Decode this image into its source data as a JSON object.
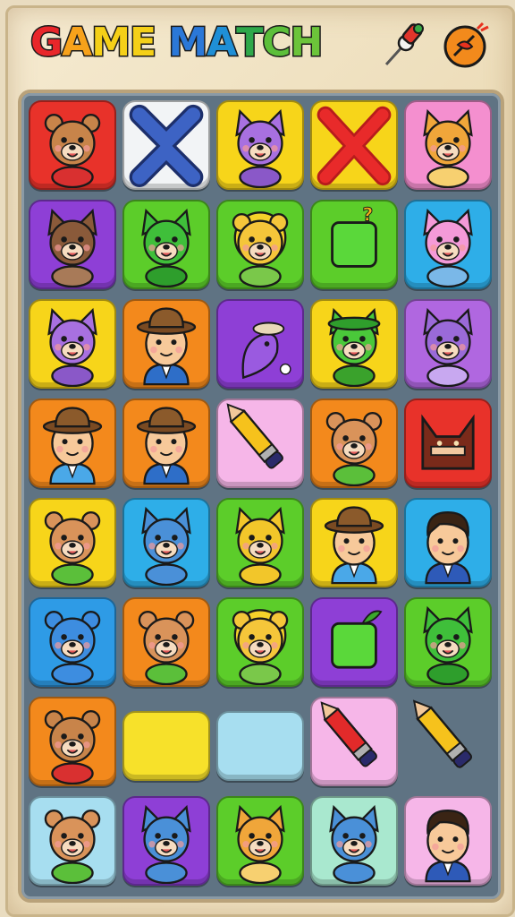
{
  "title": {
    "letters": [
      {
        "ch": "G",
        "color": "#e8262a"
      },
      {
        "ch": "A",
        "color": "#f7a21b"
      },
      {
        "ch": "M",
        "color": "#f5d018"
      },
      {
        "ch": "E",
        "color": "#f5d018"
      },
      {
        "ch": " ",
        "color": "#000000"
      },
      {
        "ch": "M",
        "color": "#2b78d8"
      },
      {
        "ch": "A",
        "color": "#1f8fd6"
      },
      {
        "ch": "T",
        "color": "#2ea84a"
      },
      {
        "ch": "C",
        "color": "#5cbf3a"
      },
      {
        "ch": "H",
        "color": "#6cc43a"
      }
    ]
  },
  "header_icons": [
    "pushpin-icon",
    "fire-shield-icon"
  ],
  "colors": {
    "red": "#e8322a",
    "white": "#f2f4f6",
    "yellow": "#f7d51a",
    "pink": "#f48fcf",
    "purple": "#8e3fd6",
    "green": "#5ccd2a",
    "lightblue": "#2eaee8",
    "orange": "#f3891c",
    "violet": "#b067e0",
    "blue": "#2e9be6",
    "paleblue": "#a7def0",
    "lightpink": "#f6b6e8",
    "mint": "#a9e8cf",
    "lightyellow": "#f7e12a"
  },
  "rows": [
    [
      {
        "bg": "red",
        "icon": "bear-man-icon"
      },
      {
        "bg": "white",
        "icon": "blue-x-icon"
      },
      {
        "bg": "yellow",
        "icon": "purple-cat-icon"
      },
      {
        "bg": "yellow",
        "icon": "red-x-icon"
      },
      {
        "bg": "pink",
        "icon": "fox-icon"
      }
    ],
    [
      {
        "bg": "purple",
        "icon": "dog-icon"
      },
      {
        "bg": "green",
        "icon": "green-cat-icon"
      },
      {
        "bg": "green",
        "icon": "sun-bear-icon"
      },
      {
        "bg": "green",
        "icon": "mystery-block-icon"
      },
      {
        "bg": "lightblue",
        "icon": "pink-cat-icon"
      }
    ],
    [
      {
        "bg": "yellow",
        "icon": "purple-cat-icon"
      },
      {
        "bg": "orange",
        "icon": "hat-man-icon"
      },
      {
        "bg": "purple",
        "icon": "hat-creature-icon"
      },
      {
        "bg": "yellow",
        "icon": "green-hat-cat-icon"
      },
      {
        "bg": "violet",
        "icon": "purple-wolf-icon"
      }
    ],
    [
      {
        "bg": "orange",
        "icon": "hat-kid-icon"
      },
      {
        "bg": "orange",
        "icon": "hat-man-icon"
      },
      {
        "bg": "lightpink",
        "icon": "pencil-icon"
      },
      {
        "bg": "orange",
        "icon": "bear-icon"
      },
      {
        "bg": "red",
        "icon": "dark-fox-icon"
      }
    ],
    [
      {
        "bg": "yellow",
        "icon": "bear-icon"
      },
      {
        "bg": "lightblue",
        "icon": "blue-cat-icon"
      },
      {
        "bg": "green",
        "icon": "yellow-fox-icon"
      },
      {
        "bg": "yellow",
        "icon": "hat-kid-icon"
      },
      {
        "bg": "lightblue",
        "icon": "man-icon"
      }
    ],
    [
      {
        "bg": "blue",
        "icon": "blue-bear-icon"
      },
      {
        "bg": "orange",
        "icon": "bear-icon"
      },
      {
        "bg": "green",
        "icon": "sun-bear-icon"
      },
      {
        "bg": "purple",
        "icon": "green-block-icon"
      },
      {
        "bg": "green",
        "icon": "green-cat-icon"
      }
    ],
    [
      {
        "bg": "orange",
        "icon": "bear-man-icon"
      },
      {
        "bg": "lightyellow",
        "icon": "empty"
      },
      {
        "bg": "paleblue",
        "icon": "empty"
      },
      {
        "bg": "lightpink",
        "icon": "red-pencil-icon"
      },
      {
        "bg": "none",
        "icon": "pencil-icon"
      }
    ],
    [
      {
        "bg": "paleblue",
        "icon": "bear-icon"
      },
      {
        "bg": "purple",
        "icon": "blue-cat-icon"
      },
      {
        "bg": "green",
        "icon": "fox-icon"
      },
      {
        "bg": "mint",
        "icon": "blue-cat-icon"
      },
      {
        "bg": "lightpink",
        "icon": "man-icon"
      }
    ]
  ]
}
